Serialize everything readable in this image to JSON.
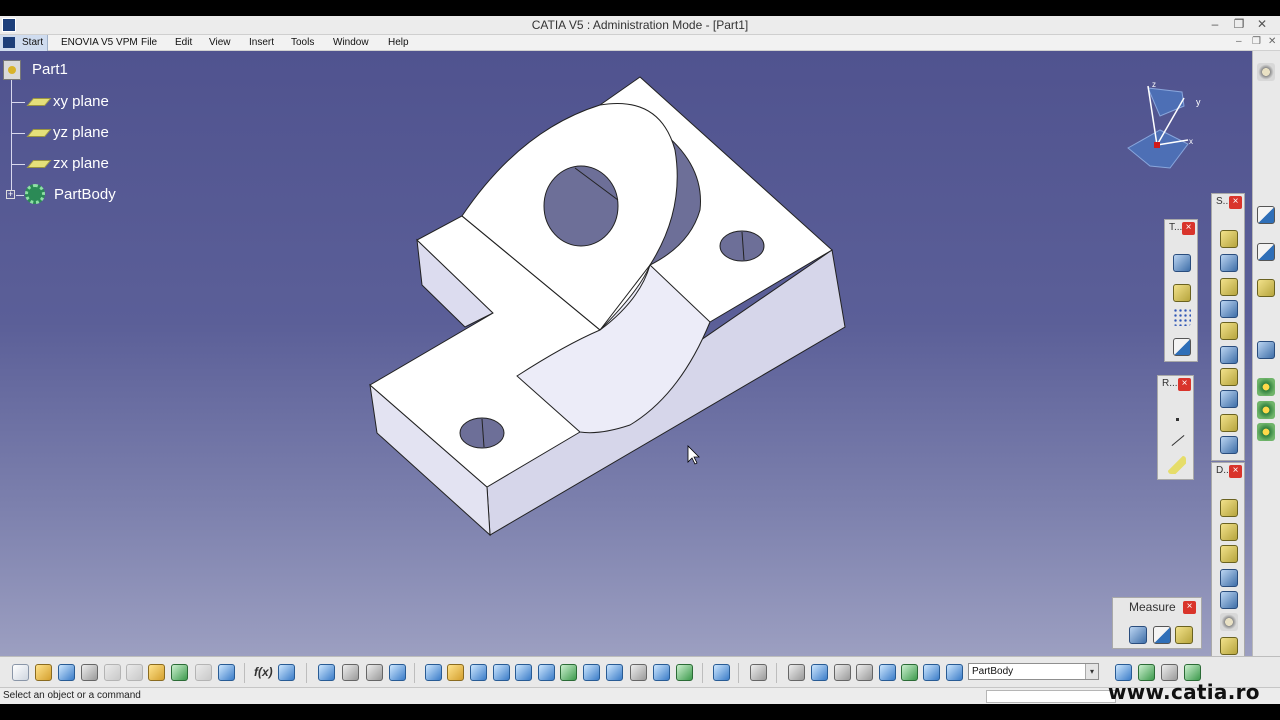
{
  "window": {
    "title": "CATIA V5 : Administration Mode - [Part1]",
    "min_glyph": "–",
    "max_glyph": "❐",
    "close_glyph": "✕"
  },
  "menu": {
    "start": "Start",
    "items": [
      "ENOVIA V5 VPM",
      "File",
      "Edit",
      "View",
      "Insert",
      "Tools",
      "Window",
      "Help"
    ]
  },
  "tree": {
    "root": "Part1",
    "children": [
      "xy plane",
      "yz plane",
      "zx plane",
      "PartBody"
    ]
  },
  "compass": {
    "axis_x": "x",
    "axis_y": "y",
    "axis_z": "z"
  },
  "panels": {
    "tools": {
      "title": "T...",
      "close": "×"
    },
    "sketch": {
      "title": "S...",
      "close": "×"
    },
    "reference": {
      "title": "R...",
      "close": "×"
    },
    "dress": {
      "title": "D...",
      "close": "×"
    },
    "measure": {
      "title": "Measure",
      "close": "×"
    }
  },
  "bottom_toolbar": {
    "formula_label": "f(x)",
    "body_combo": "PartBody",
    "combo_arrow": "▾"
  },
  "status": {
    "prompt": "Select an object or a command"
  },
  "watermark": "www.catia.ro",
  "colors": {
    "viewport_top": "#50538f",
    "viewport_bottom": "#9c9fc1",
    "model_face": "#ffffff",
    "model_shade": "#dcdcef",
    "accent_close": "#d9342b"
  }
}
